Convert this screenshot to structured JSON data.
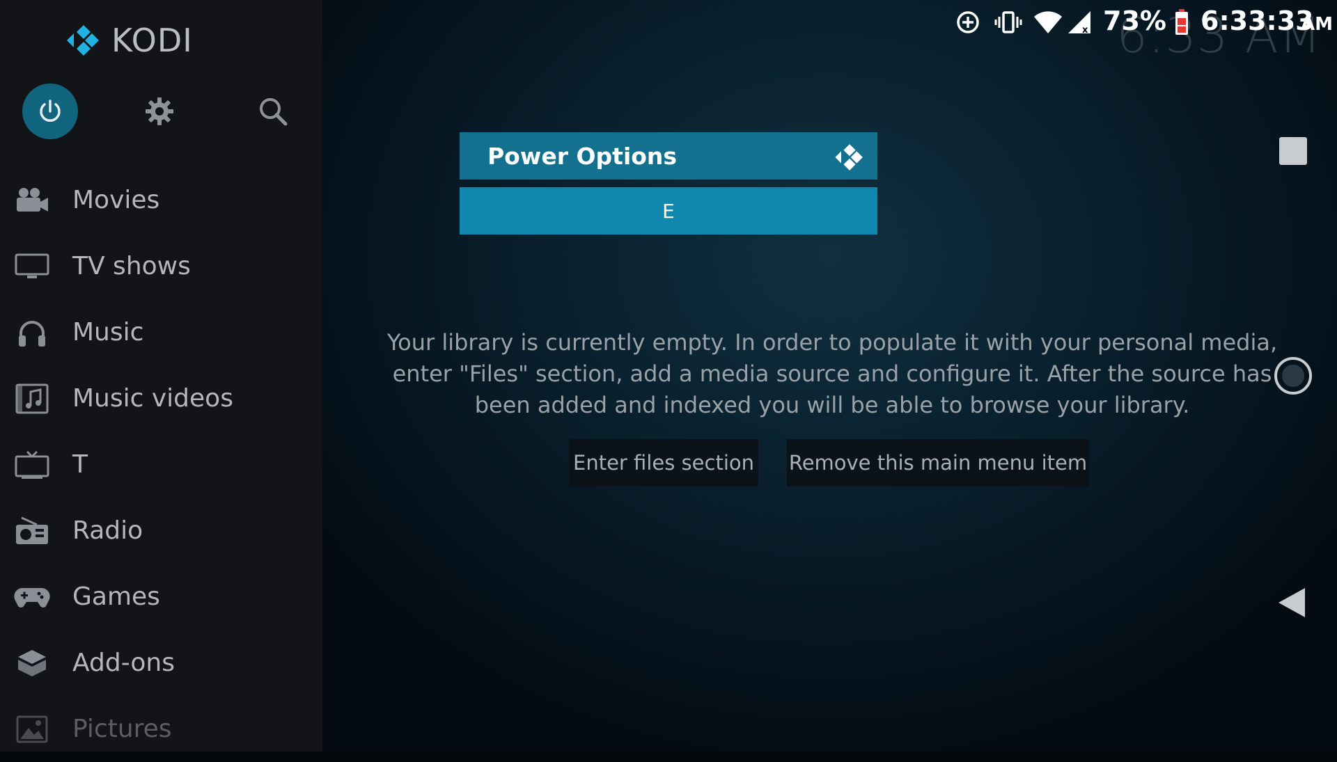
{
  "app": {
    "logo_text": "KODI"
  },
  "status_bar": {
    "battery_percent": "73%",
    "time": "6:33:33",
    "ampm": "AM"
  },
  "background_clock": "6:33 AM",
  "top_icons": [
    "power-icon",
    "gear-icon",
    "search-icon"
  ],
  "sidebar": {
    "items": [
      {
        "label": "Movies",
        "icon": "movie-camera-icon"
      },
      {
        "label": "TV shows",
        "icon": "monitor-icon"
      },
      {
        "label": "Music",
        "icon": "headphones-icon"
      },
      {
        "label": "Music videos",
        "icon": "music-video-icon"
      },
      {
        "label": "T",
        "icon": "tv-icon"
      },
      {
        "label": "Radio",
        "icon": "radio-icon"
      },
      {
        "label": "Games",
        "icon": "gamepad-icon"
      },
      {
        "label": "Add-ons",
        "icon": "addons-box-icon"
      },
      {
        "label": "Pictures",
        "icon": "picture-icon"
      }
    ]
  },
  "dialog": {
    "title": "Power Options",
    "option": "E"
  },
  "main": {
    "empty_message": "Your library is currently empty. In order to populate it with your personal media, enter \"Files\" section, add a media source and configure it. After the source has been added and indexed you will be able to browse your library.",
    "enter_files_label": "Enter files section",
    "remove_item_label": "Remove this main menu item"
  },
  "colors": {
    "accent": "#13708f",
    "option_highlight": "#1187ad",
    "sidebar_bg": "#121417",
    "power_button": "#12657f"
  }
}
